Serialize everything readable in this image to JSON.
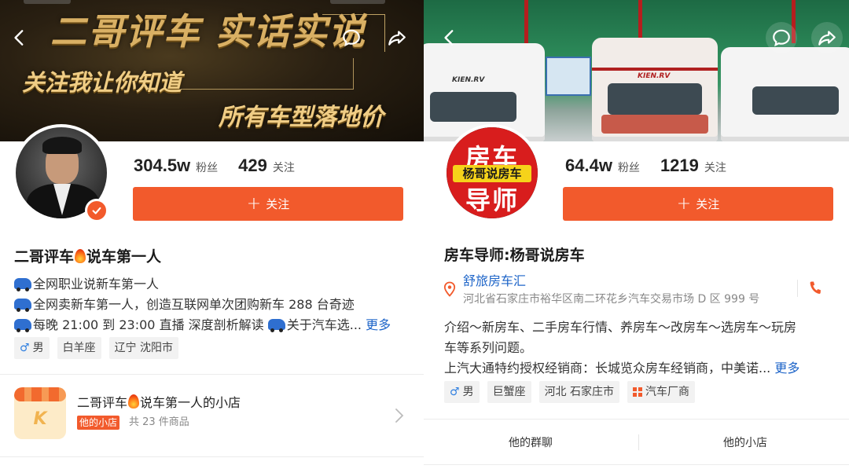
{
  "left": {
    "banner": {
      "title": "二哥评车 实话实说",
      "line1": "关注我让你知道",
      "line2": "所有车型落地价"
    },
    "nav": {
      "back_icon": "back-arrow-icon",
      "comment_icon": "comment-bubble-icon",
      "share_icon": "share-arrow-icon"
    },
    "stats": {
      "followers_value": "304.5w",
      "followers_label": "粉丝",
      "following_value": "429",
      "following_label": "关注"
    },
    "follow_button": {
      "label": "关注"
    },
    "name_part1": "二哥评车",
    "name_part2": "说车第一人",
    "bio": {
      "line1": "全网职业说新车第一人",
      "line2": "全网卖新车第一人，创造互联网单次团购新车 288 台奇迹",
      "line3a": "每晚 21:00 到 23:00 直播 深度剖析解读",
      "line3b": "关于汽车选...",
      "more": "更多"
    },
    "tags": {
      "gender": "男",
      "zodiac": "白羊座",
      "location": "辽宁 沈阳市"
    },
    "shop": {
      "icon_letter": "K",
      "title_part1": "二哥评车",
      "title_part2": "说车第一人的小店",
      "badge": "他的小店",
      "count": "共 23 件商品"
    }
  },
  "right": {
    "banner": {
      "brand1": "KIEN.RV",
      "brand2": "KIEN.RV"
    },
    "nav": {
      "back_icon": "back-arrow-icon",
      "comment_icon": "comment-bubble-icon",
      "share_icon": "share-arrow-icon"
    },
    "logo": {
      "top": "房车",
      "band": "杨哥说房车",
      "bottom": "导师"
    },
    "stats": {
      "followers_value": "64.4w",
      "followers_label": "粉丝",
      "following_value": "1219",
      "following_label": "关注"
    },
    "follow_button": {
      "label": "关注"
    },
    "name": "房车导师:杨哥说房车",
    "location": {
      "name": "舒旅房车汇",
      "address": "河北省石家庄市裕华区南二环花乡汽车交易市场 D 区 999 号"
    },
    "bio": {
      "line1": "介绍～新房车、二手房车行情、养房车～改房车～选房车～玩房",
      "line2": "车等系列问题。",
      "line3": "上汽大通特约授权经销商：长城览众房车经销商，中美诺...",
      "more": "更多"
    },
    "tags": {
      "gender": "男",
      "zodiac": "巨蟹座",
      "location": "河北 石家庄市",
      "category": "汽车厂商"
    },
    "footer": {
      "tab1": "他的群聊",
      "tab2": "他的小店"
    }
  },
  "colors": {
    "accent": "#f25a2c",
    "link": "#1d64c8",
    "tag_bg": "#f2f2f2"
  }
}
